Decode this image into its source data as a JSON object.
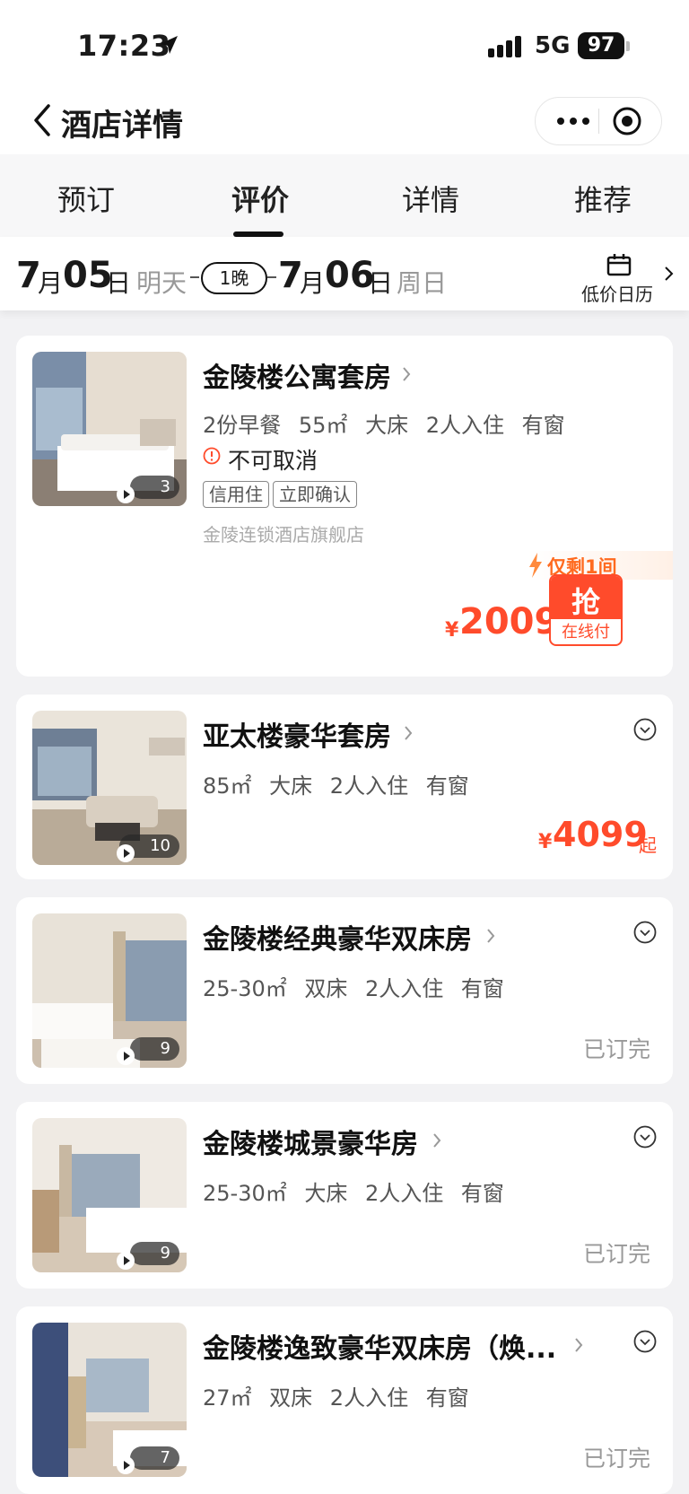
{
  "status_bar": {
    "time": "17:23",
    "network": "5G",
    "battery": "97"
  },
  "nav": {
    "title": "酒店详情"
  },
  "tabs": [
    {
      "label": "预订",
      "active": false
    },
    {
      "label": "评价",
      "active": true
    },
    {
      "label": "详情",
      "active": false
    },
    {
      "label": "推荐",
      "active": false
    }
  ],
  "date_bar": {
    "checkin": {
      "month": "7",
      "month_unit": "月",
      "day": "05",
      "day_unit": "日",
      "weekday": "明天"
    },
    "nights": "1晚",
    "checkout": {
      "month": "7",
      "month_unit": "月",
      "day": "06",
      "day_unit": "日",
      "weekday": "周日"
    },
    "calendar_label": "低价日历"
  },
  "rooms": [
    {
      "name": "金陵楼公寓套房",
      "info": "2份早餐 55㎡ 大床 2人入住 有窗",
      "cancel": "不可取消",
      "tags": [
        "信用住",
        "立即确认"
      ],
      "shop": "金陵连锁酒店旗舰店",
      "stock": "仅剩1间",
      "currency": "¥",
      "price": "2009",
      "book_label": "抢",
      "book_sub": "在线付",
      "photo_count": "3"
    },
    {
      "name": "亚太楼豪华套房",
      "info": "85㎡ 大床 2人入住 有窗",
      "currency": "¥",
      "price": "4099",
      "price_suffix": "起",
      "photo_count": "10"
    },
    {
      "name": "金陵楼经典豪华双床房",
      "info": "25-30㎡ 双床 2人入住 有窗",
      "status": "已订完",
      "photo_count": "9"
    },
    {
      "name": "金陵楼城景豪华房",
      "info": "25-30㎡ 大床 2人入住 有窗",
      "status": "已订完",
      "photo_count": "9"
    },
    {
      "name": "金陵楼逸致豪华双床房（焕...",
      "info": "27㎡ 双床 2人入住 有窗",
      "status": "已订完",
      "photo_count": "7"
    }
  ],
  "colors": {
    "accent": "#ff4b2b",
    "price": "#ff4b2b",
    "stock": "#ff6a1f"
  }
}
